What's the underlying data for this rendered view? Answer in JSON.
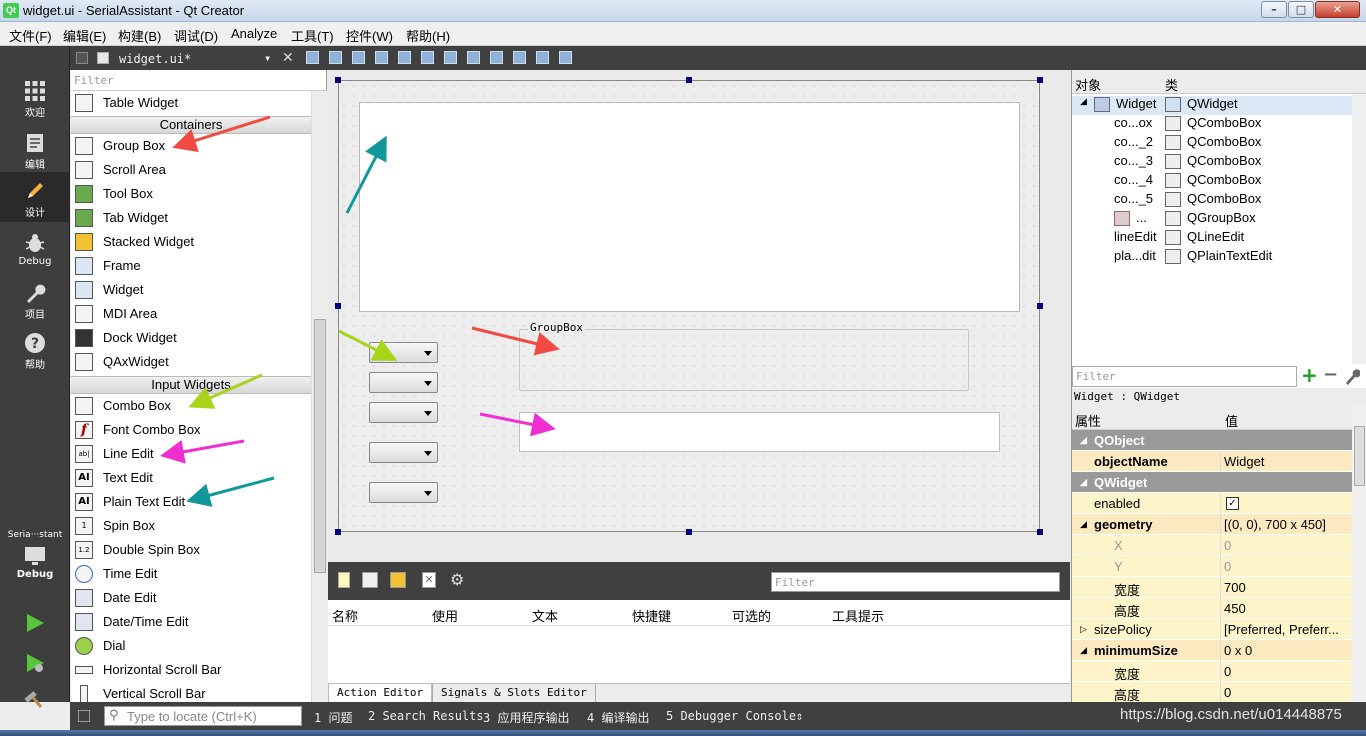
{
  "window": {
    "title": "widget.ui - SerialAssistant - Qt Creator",
    "app_icon": "Qt"
  },
  "menu": [
    "文件(F)",
    "编辑(E)",
    "构建(B)",
    "调试(D)",
    "Analyze",
    "工具(T)",
    "控件(W)",
    "帮助(H)"
  ],
  "modes": [
    {
      "label": "欢迎",
      "icon": "grid-icon"
    },
    {
      "label": "编辑",
      "icon": "edit-doc-icon"
    },
    {
      "label": "设计",
      "icon": "pencil-icon"
    },
    {
      "label": "Debug",
      "icon": "bug-icon"
    },
    {
      "label": "项目",
      "icon": "wrench-icon"
    },
    {
      "label": "帮助",
      "icon": "help-icon"
    }
  ],
  "kit": {
    "name": "Seria···stant",
    "mode": "Debug"
  },
  "editor_tab": {
    "file": "widget.ui*"
  },
  "widget_box": {
    "filter_placeholder": "Filter",
    "items_top": [
      "Table Widget"
    ],
    "cat_containers": "Containers",
    "containers": [
      "Group Box",
      "Scroll Area",
      "Tool Box",
      "Tab Widget",
      "Stacked Widget",
      "Frame",
      "Widget",
      "MDI Area",
      "Dock Widget",
      "QAxWidget"
    ],
    "cat_input": "Input Widgets",
    "inputs": [
      "Combo Box",
      "Font Combo Box",
      "Line Edit",
      "Text Edit",
      "Plain Text Edit",
      "Spin Box",
      "Double Spin Box",
      "Time Edit",
      "Date Edit",
      "Date/Time Edit",
      "Dial",
      "Horizontal Scroll Bar",
      "Vertical Scroll Bar"
    ]
  },
  "form": {
    "groupbox_title": "GroupBox"
  },
  "action_editor": {
    "filter_placeholder": "Filter",
    "columns": [
      "名称",
      "使用",
      "文本",
      "快捷键",
      "可选的",
      "工具提示"
    ],
    "tabs": [
      "Action Editor",
      "Signals & Slots Editor"
    ]
  },
  "object_inspector": {
    "col_object": "对象",
    "col_class": "类",
    "rows": [
      {
        "name": "Widget",
        "cls": "QWidget"
      },
      {
        "name": "co...ox",
        "cls": "QComboBox"
      },
      {
        "name": "co..._2",
        "cls": "QComboBox"
      },
      {
        "name": "co..._3",
        "cls": "QComboBox"
      },
      {
        "name": "co..._4",
        "cls": "QComboBox"
      },
      {
        "name": "co..._5",
        "cls": "QComboBox"
      },
      {
        "name": "...",
        "cls": "QGroupBox"
      },
      {
        "name": "lineEdit",
        "cls": "QLineEdit"
      },
      {
        "name": "pla...dit",
        "cls": "QPlainTextEdit"
      }
    ]
  },
  "property_editor": {
    "filter_placeholder": "Filter",
    "class_line": "Widget : QWidget",
    "col_prop": "属性",
    "col_val": "值",
    "rows": [
      {
        "name": "QObject",
        "value": "",
        "kind": "sect"
      },
      {
        "name": "objectName",
        "value": "Widget",
        "kind": "yl2"
      },
      {
        "name": "QWidget",
        "value": "",
        "kind": "sect"
      },
      {
        "name": "enabled",
        "value": "✓",
        "kind": "chk"
      },
      {
        "name": "geometry",
        "value": "[(0, 0), 700 x 450]",
        "kind": "yl2"
      },
      {
        "name": "X",
        "value": "0",
        "kind": "sub"
      },
      {
        "name": "Y",
        "value": "0",
        "kind": "sub"
      },
      {
        "name": "宽度",
        "value": "700",
        "kind": "sub"
      },
      {
        "name": "高度",
        "value": "450",
        "kind": "sub"
      },
      {
        "name": "sizePolicy",
        "value": "[Preferred, Preferr...",
        "kind": "yl"
      },
      {
        "name": "minimumSize",
        "value": "0 x 0",
        "kind": "yl2"
      },
      {
        "name": "宽度",
        "value": "0",
        "kind": "sub"
      },
      {
        "name": "高度",
        "value": "0",
        "kind": "sub"
      }
    ]
  },
  "statusbar": {
    "locate_placeholder": "Type to locate (Ctrl+K)",
    "tabs": [
      "1 问题",
      "2 Search Results",
      "3 应用程序输出",
      "4 编译输出",
      "5 Debugger Console"
    ],
    "watermark": "https://blog.csdn.net/u014448875"
  },
  "colors": {
    "accent_red": "#f04a43",
    "accent_green": "#a8d41c",
    "accent_pink": "#f02fd2",
    "accent_teal": "#12989a"
  }
}
